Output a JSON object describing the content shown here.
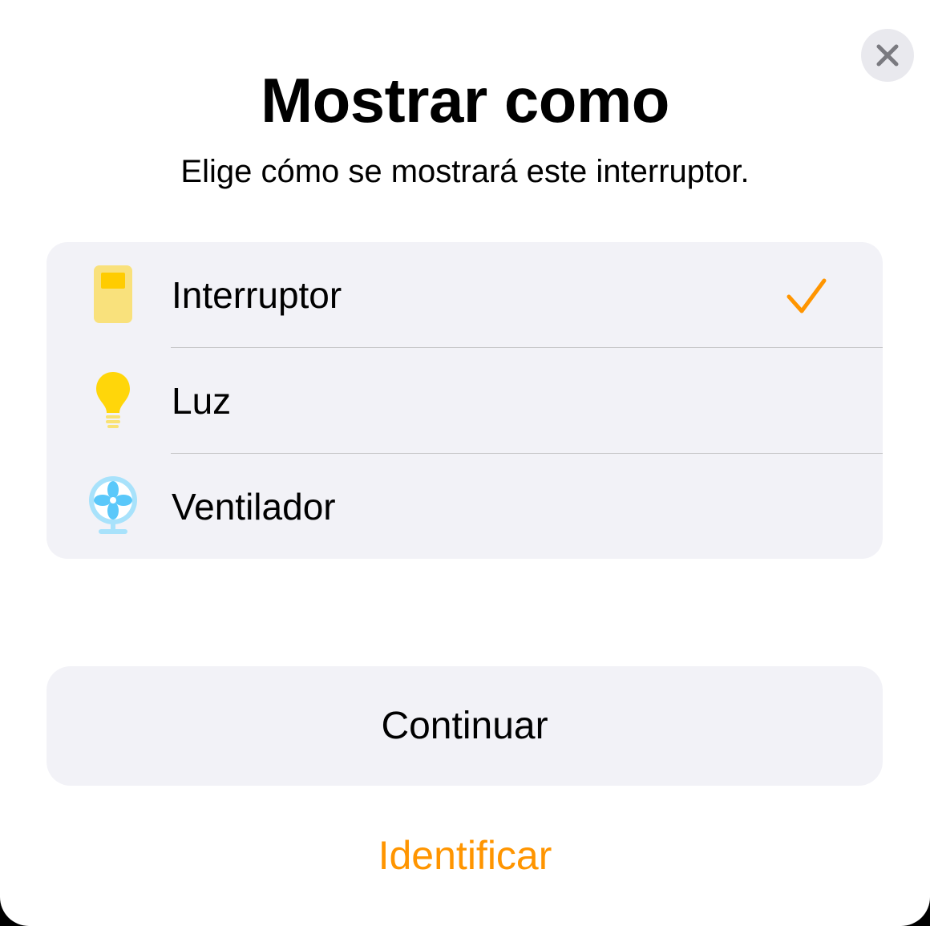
{
  "dialog": {
    "title": "Mostrar como",
    "subtitle": "Elige cómo se mostrará este interruptor.",
    "close_icon": "close-icon"
  },
  "options": [
    {
      "label": "Interruptor",
      "icon": "switch-icon",
      "selected": true
    },
    {
      "label": "Luz",
      "icon": "lightbulb-icon",
      "selected": false
    },
    {
      "label": "Ventilador",
      "icon": "fan-icon",
      "selected": false
    }
  ],
  "actions": {
    "continue_label": "Continuar",
    "identify_label": "Identificar"
  },
  "colors": {
    "accent": "#ff9500",
    "switch": "#ffcc00",
    "switch_body": "#f9e17c",
    "bulb": "#ffd60a",
    "fan": "#5ac8fa",
    "fan_light": "#a8e2fb",
    "group_background": "#f2f2f7"
  }
}
